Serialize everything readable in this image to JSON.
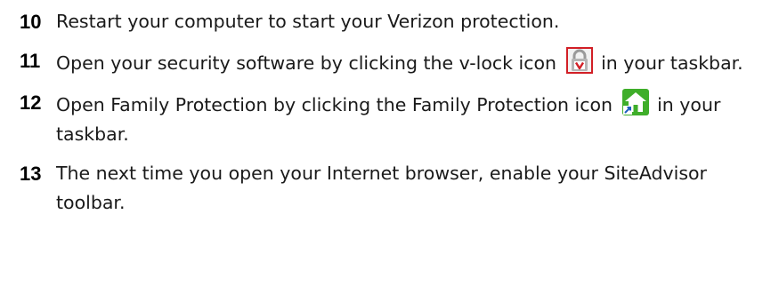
{
  "steps": [
    {
      "number": "10",
      "text": "Restart your computer to start your Verizon protection."
    },
    {
      "number": "11",
      "text_before": "Open your security software by clicking the v-lock icon",
      "icon": "v-lock-icon",
      "text_after": "in your taskbar."
    },
    {
      "number": "12",
      "text_before": "Open Family Protection by clicking the Family Protection icon",
      "icon": "family-protection-icon",
      "text_after": "in your taskbar."
    },
    {
      "number": "13",
      "text": "The next time you open your Internet browser, enable your SiteAdvisor toolbar."
    }
  ],
  "colors": {
    "text": "#1a1a1a",
    "vlock_red": "#d21f26",
    "family_green": "#3fae2a"
  }
}
